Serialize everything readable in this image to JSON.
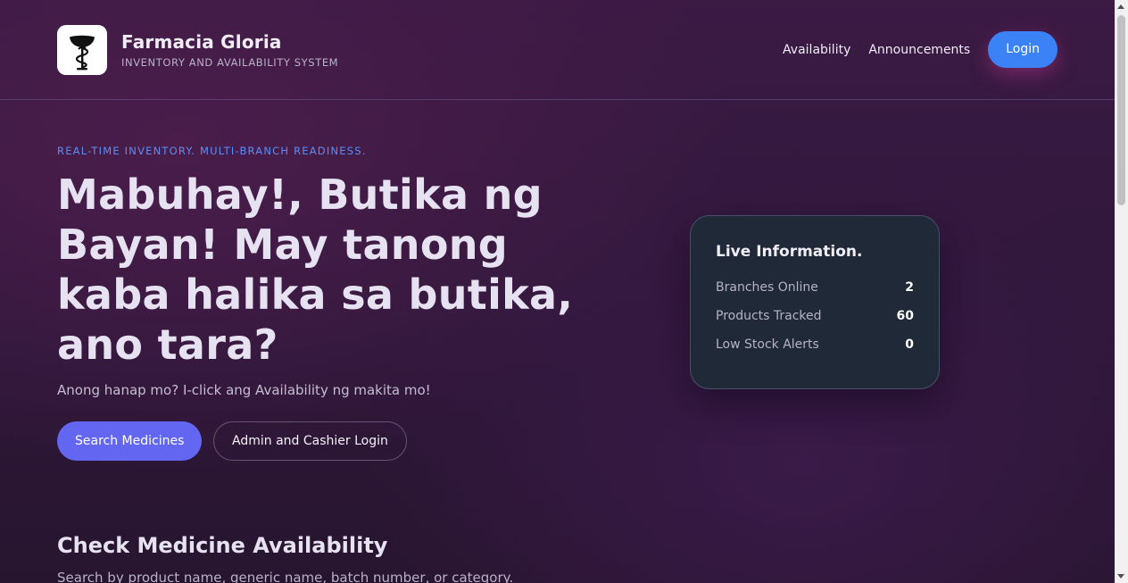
{
  "brand": {
    "name": "Farmacia Gloria",
    "subtitle": "INVENTORY AND AVAILABILITY SYSTEM",
    "logo_icon": "pharmacy-caduceus-icon"
  },
  "nav": {
    "items": [
      "Availability",
      "Announcements"
    ],
    "login_label": "Login"
  },
  "hero": {
    "eyebrow": "REAL-TIME INVENTORY. MULTI-BRANCH READINESS.",
    "title": "Mabuhay!, Butika ng Bayan! May tanong kaba halika sa butika, ano tara?",
    "subtitle": "Anong hanap mo? I-click ang Availability ng makita mo!",
    "primary_button": "Search Medicines",
    "secondary_button": "Admin and Cashier Login"
  },
  "live_info": {
    "title": "Live Information.",
    "rows": [
      {
        "label": "Branches Online",
        "value": "2"
      },
      {
        "label": "Products Tracked",
        "value": "60"
      },
      {
        "label": "Low Stock Alerts",
        "value": "0"
      }
    ]
  },
  "section": {
    "title": "Check Medicine Availability",
    "subtitle": "Search by product name, generic name, batch number, or category."
  },
  "colors": {
    "accent_blue": "#3b82f6",
    "primary_button": "#6366f1",
    "eyebrow": "#5b8df7",
    "card_bg": "#1f2937"
  }
}
